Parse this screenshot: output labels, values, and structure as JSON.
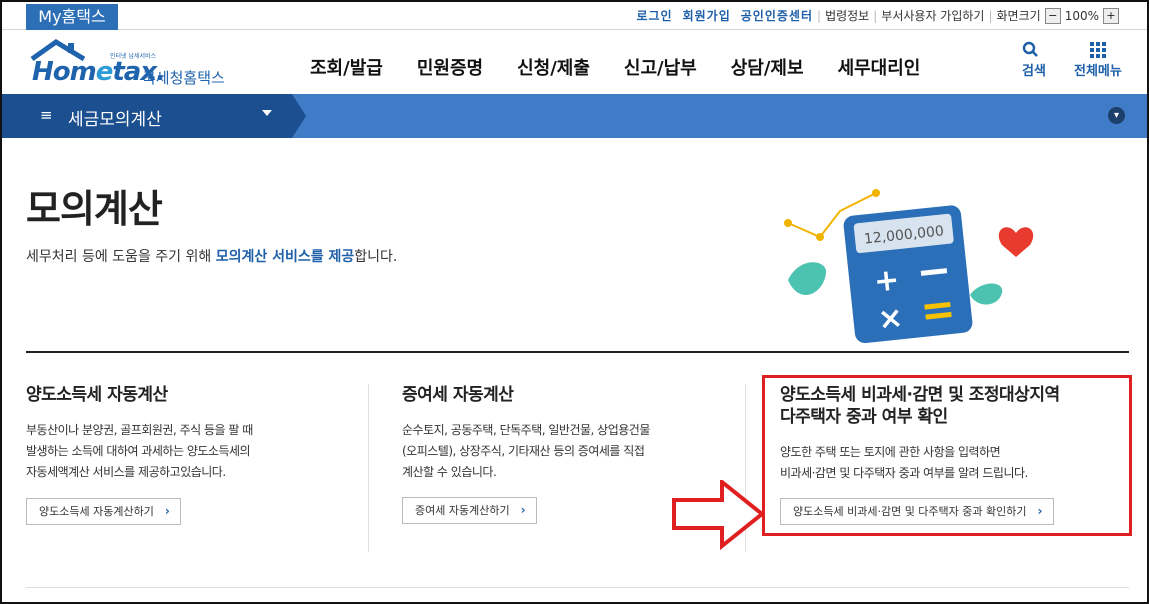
{
  "top": {
    "my_tab": "My홈택스",
    "links": [
      "로그인",
      "회원가입",
      "공인인증센터"
    ],
    "gray_links": [
      "법령정보",
      "부서사용자 가입하기",
      "화면크기"
    ],
    "zoom_minus": "−",
    "zoom_level": "100%",
    "zoom_plus": "+"
  },
  "header": {
    "logo_brand_main": "Hom",
    "logo_brand_e": "e",
    "logo_brand_tail": "tax.",
    "logo_small": "인터넷 납세서비스",
    "logo_kr": "국세청홈택스",
    "menu": [
      "조회/발급",
      "민원증명",
      "신청/제출",
      "신고/납부",
      "상담/제보",
      "세무대리인"
    ],
    "search_label": "검색",
    "search_icon": "search-icon",
    "allmenu_label": "전체메뉴",
    "allmenu_icon": "grid-icon"
  },
  "navbar": {
    "hamburger": "≡",
    "current": "세금모의계산"
  },
  "page": {
    "title": "모의계산",
    "desc_pre": "세무처리 등에 도움을 주기 위해 ",
    "desc_hl": "모의계산 서비스를 제공",
    "desc_post": "합니다.",
    "illus_value": "12,000,000"
  },
  "cards": [
    {
      "title": "양도소득세 자동계산",
      "lines": [
        "부동산이나 분양권, 골프회원권, 주식 등을 팔 때",
        "발생하는 소득에 대하여 과세하는 양도소득세의",
        "자동세액계산 서비스를 제공하고있습니다."
      ],
      "button": "양도소득세 자동계산하기"
    },
    {
      "title": "증여세 자동계산",
      "lines": [
        "순수토지, 공동주택, 단독주택, 일반건물, 상업용건물",
        "(오피스텔), 상장주식, 기타재산 등의 증여세를 직접",
        "계산할 수 있습니다."
      ],
      "button": "증여세 자동계산하기"
    },
    {
      "title_line1": "양도소득세 비과세·감면 및 조정대상지역",
      "title_line2": "다주택자 중과 여부 확인",
      "lines": [
        "양도한 주택 또는 토지에 관한 사항을 입력하면",
        "비과세·감면 및 다주택자 중과 여부를 알려 드립니다."
      ],
      "button": "양도소득세 비과세·감면 및 다주택자 중과 확인하기"
    }
  ],
  "button_arrow": "›",
  "colors": {
    "brand": "#1d5fa8",
    "nav_light": "#3f7bc6",
    "nav_dark": "#1c4f8f",
    "highlight": "#e02020"
  }
}
